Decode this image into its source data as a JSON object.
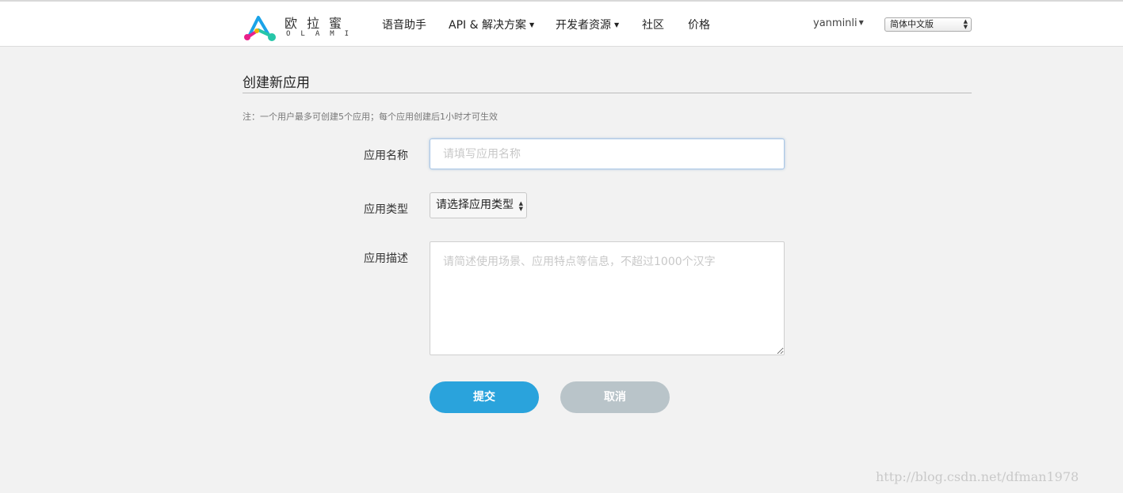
{
  "header": {
    "logo_cn": "欧拉蜜",
    "logo_en": "OLAMI",
    "nav": [
      {
        "label": "语音助手"
      },
      {
        "label": "API & 解决方案"
      },
      {
        "label": "开发者资源"
      },
      {
        "label": "社区"
      },
      {
        "label": "价格"
      }
    ],
    "user": "yanminli",
    "language": "简体中文版"
  },
  "page": {
    "title": "创建新应用",
    "note": "注：一个用户最多可创建5个应用；每个应用创建后1小时才可生效"
  },
  "form": {
    "name_label": "应用名称",
    "name_placeholder": "请填写应用名称",
    "name_value": "",
    "type_label": "应用类型",
    "type_selected": "请选择应用类型",
    "desc_label": "应用描述",
    "desc_placeholder": "请简述使用场景、应用特点等信息，不超过1000个汉字",
    "desc_value": "",
    "submit_label": "提交",
    "cancel_label": "取消"
  },
  "watermark": "http://blog.csdn.net/dfman1978",
  "colors": {
    "primary": "#2aa3dc",
    "cancel": "#b9c4c9",
    "background": "#f2f2f2"
  }
}
